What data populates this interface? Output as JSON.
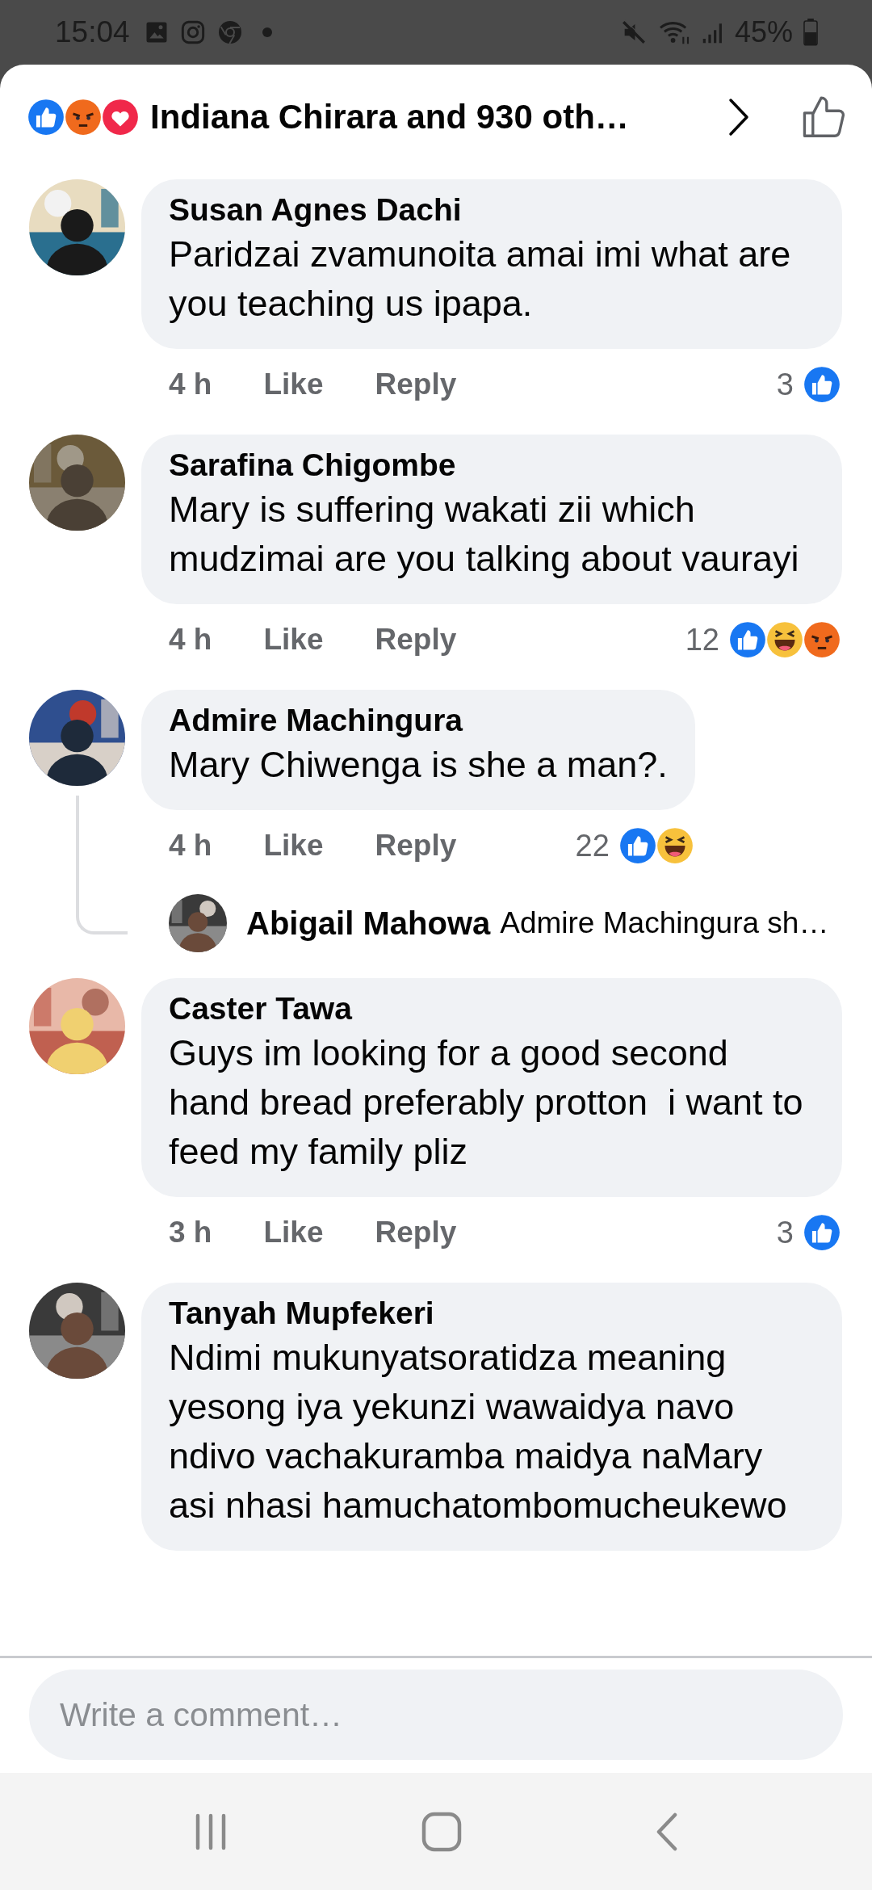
{
  "status_bar": {
    "time": "15:04",
    "battery": "45%"
  },
  "header": {
    "reactions": [
      {
        "kind": "like"
      },
      {
        "kind": "angry"
      },
      {
        "kind": "love"
      }
    ],
    "title": "Indiana Chirara and 930 oth…"
  },
  "comments": [
    {
      "author": "Susan Agnes Dachi",
      "text": "Paridzai zvamunoita amai imi what are you teaching us ipapa.",
      "time": "4 h",
      "like_label": "Like",
      "reply_label": "Reply",
      "reaction_count": "3",
      "reactions": [
        {
          "kind": "like"
        }
      ]
    },
    {
      "author": "Sarafina Chigombe",
      "text": "Mary is suffering wakati zii which mudzimai are you talking about vaurayi",
      "time": "4 h",
      "like_label": "Like",
      "reply_label": "Reply",
      "reaction_count": "12",
      "reactions": [
        {
          "kind": "like"
        },
        {
          "kind": "haha"
        },
        {
          "kind": "angry"
        }
      ]
    },
    {
      "author": "Admire Machingura",
      "text": "Mary Chiwenga is she a man?.",
      "time": "4 h",
      "like_label": "Like",
      "reply_label": "Reply",
      "reaction_count": "22",
      "reactions": [
        {
          "kind": "like"
        },
        {
          "kind": "haha"
        }
      ],
      "replies": [
        {
          "author": "Abigail Mahowa",
          "text": "Admire Machingura sh…"
        }
      ]
    },
    {
      "author": "Caster Tawa",
      "text": "Guys im looking for a good second hand bread preferably protton  i want to feed my family pliz",
      "time": "3 h",
      "like_label": "Like",
      "reply_label": "Reply",
      "reaction_count": "3",
      "reactions": [
        {
          "kind": "like"
        }
      ]
    },
    {
      "author": "Tanyah Mupfekeri",
      "text": "Ndimi mukunyatsoratidza meaning yesong iya yekunzi wawaidya navo ndivo vachakuramba maidya naMary asi nhasi hamuchatombomucheukewo"
    }
  ],
  "composer": {
    "placeholder": "Write a comment…"
  }
}
